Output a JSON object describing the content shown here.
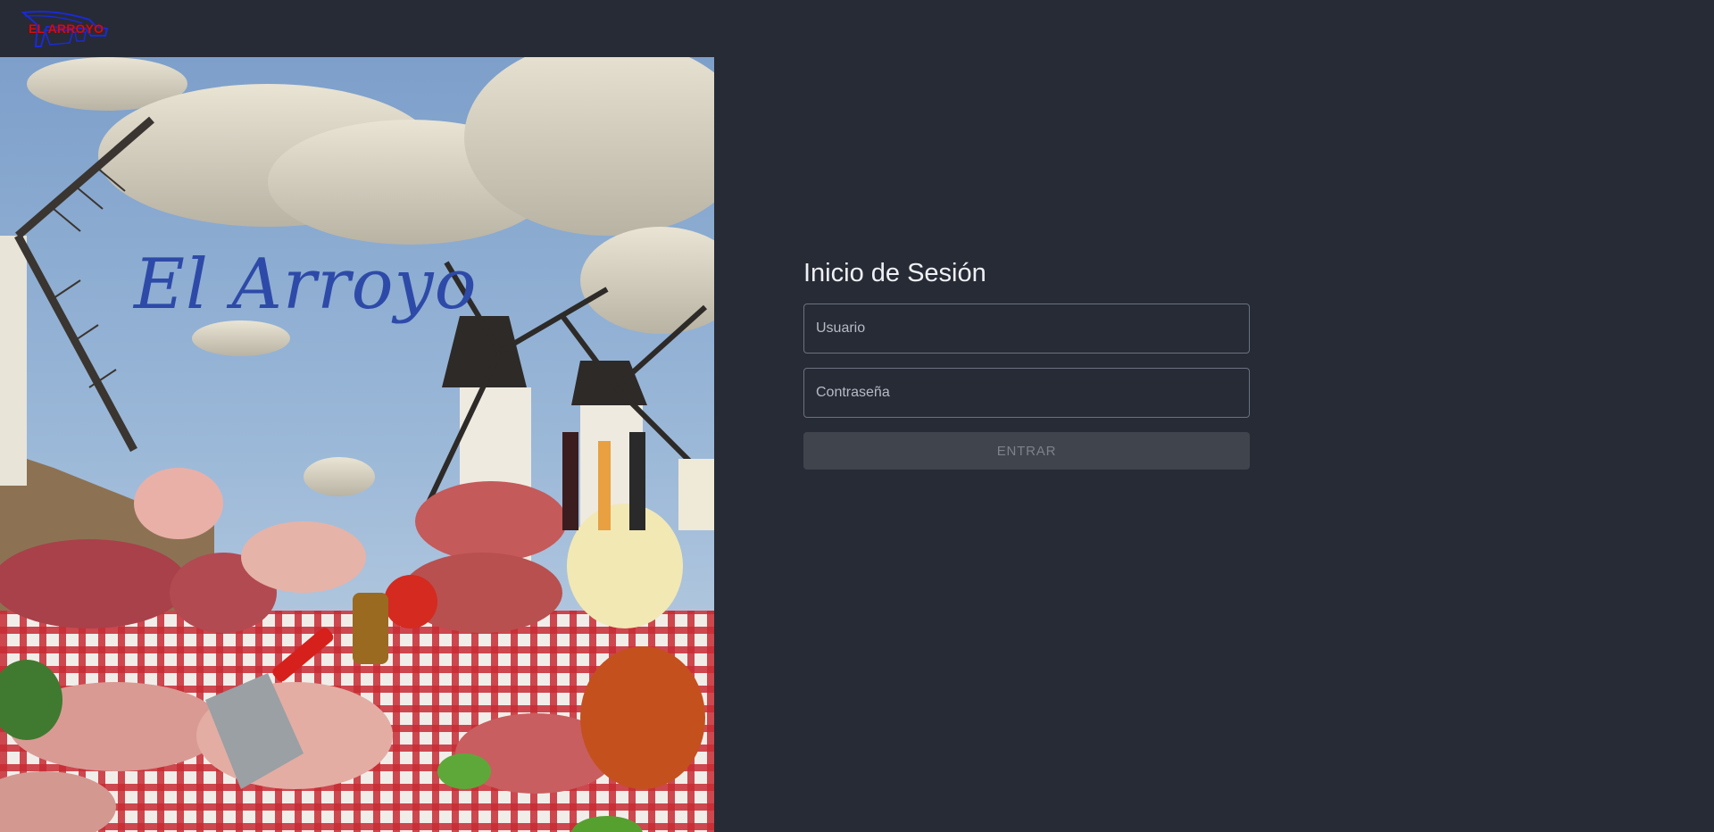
{
  "header": {
    "logo_text": "EL ARROYO"
  },
  "hero": {
    "title": "El Arroyo"
  },
  "login": {
    "title": "Inicio de Sesión",
    "username_placeholder": "Usuario",
    "password_placeholder": "Contraseña",
    "submit_label": "ENTRAR"
  },
  "colors": {
    "background": "#272b35",
    "field_border": "#6b7280",
    "button_bg": "#40444d",
    "button_text": "#7d818a",
    "logo_red": "#d10d0d",
    "hero_title_blue": "#2e4aa8"
  }
}
